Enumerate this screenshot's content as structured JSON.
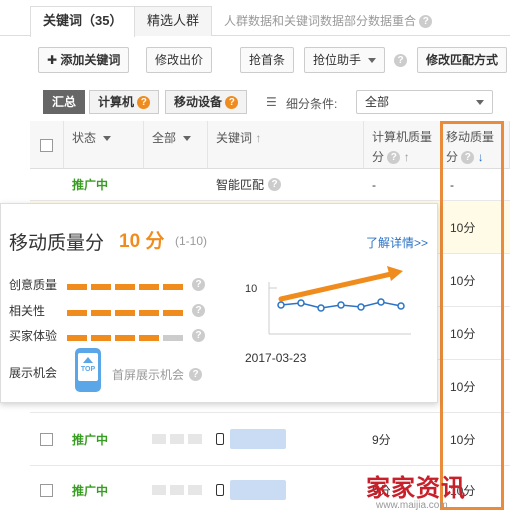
{
  "tabs": {
    "items": [
      {
        "label": "关键词（35）"
      },
      {
        "label": "精选人群"
      }
    ],
    "hint": "人群数据和关键词数据部分数据重合"
  },
  "toolbar": {
    "add_keyword": "添加关键词",
    "modify_bid": "修改出价",
    "grab_top": "抢首条",
    "position_helper": "抢位助手",
    "modify_match": "修改匹配方式"
  },
  "filters": {
    "summary": "汇总",
    "computer": "计算机",
    "mobile": "移动设备",
    "subdivide_label": "细分条件:",
    "subdivide_value": "全部"
  },
  "table": {
    "headers": {
      "status": "状态",
      "all": "全部",
      "keyword": "关键词",
      "pc_quality": "计算机质量分",
      "mobile_quality": "移动质量分"
    },
    "rows": [
      {
        "status": "推广中",
        "keyword": "智能匹配",
        "pc": "-",
        "mobile": "-"
      },
      {
        "status": "",
        "keyword": "",
        "pc": "",
        "mobile": "10分"
      },
      {
        "status": "",
        "keyword": "",
        "pc": "",
        "mobile": "10分"
      },
      {
        "status": "",
        "keyword": "",
        "pc": "",
        "mobile": "10分"
      },
      {
        "status": "",
        "keyword": "",
        "pc": "",
        "mobile": "10分"
      },
      {
        "status": "推广中",
        "keyword": "",
        "pc": "9分",
        "mobile": "10分"
      },
      {
        "status": "推广中",
        "keyword": "",
        "pc": "9分",
        "mobile": "10分"
      }
    ]
  },
  "popup": {
    "title": "移动质量分",
    "score": "10 分",
    "range": "(1-10)",
    "link": "了解详情>>",
    "metrics": [
      {
        "label": "创意质量",
        "filled": 5,
        "total": 5
      },
      {
        "label": "相关性",
        "filled": 5,
        "total": 5
      },
      {
        "label": "买家体验",
        "filled": 4,
        "total": 5
      }
    ],
    "display_label": "展示机会",
    "display_value": "首屏展示机会",
    "chart_ytick": "10",
    "chart_date": "2017-03-23",
    "top_badge": "TOP"
  },
  "watermark": {
    "text": "家家资讯",
    "sub": "www.maijia.com"
  },
  "colors": {
    "accent_orange": "#f08c1e",
    "status_green": "#3a9d23",
    "link_blue": "#2a73c6",
    "highlight_border": "#e98b3a"
  },
  "chart_data": {
    "type": "line",
    "x": [
      "2017-03-23"
    ],
    "series": [
      {
        "values": [
          10,
          10,
          10,
          10,
          10,
          10,
          10
        ]
      }
    ],
    "ylim": [
      9,
      11
    ]
  }
}
